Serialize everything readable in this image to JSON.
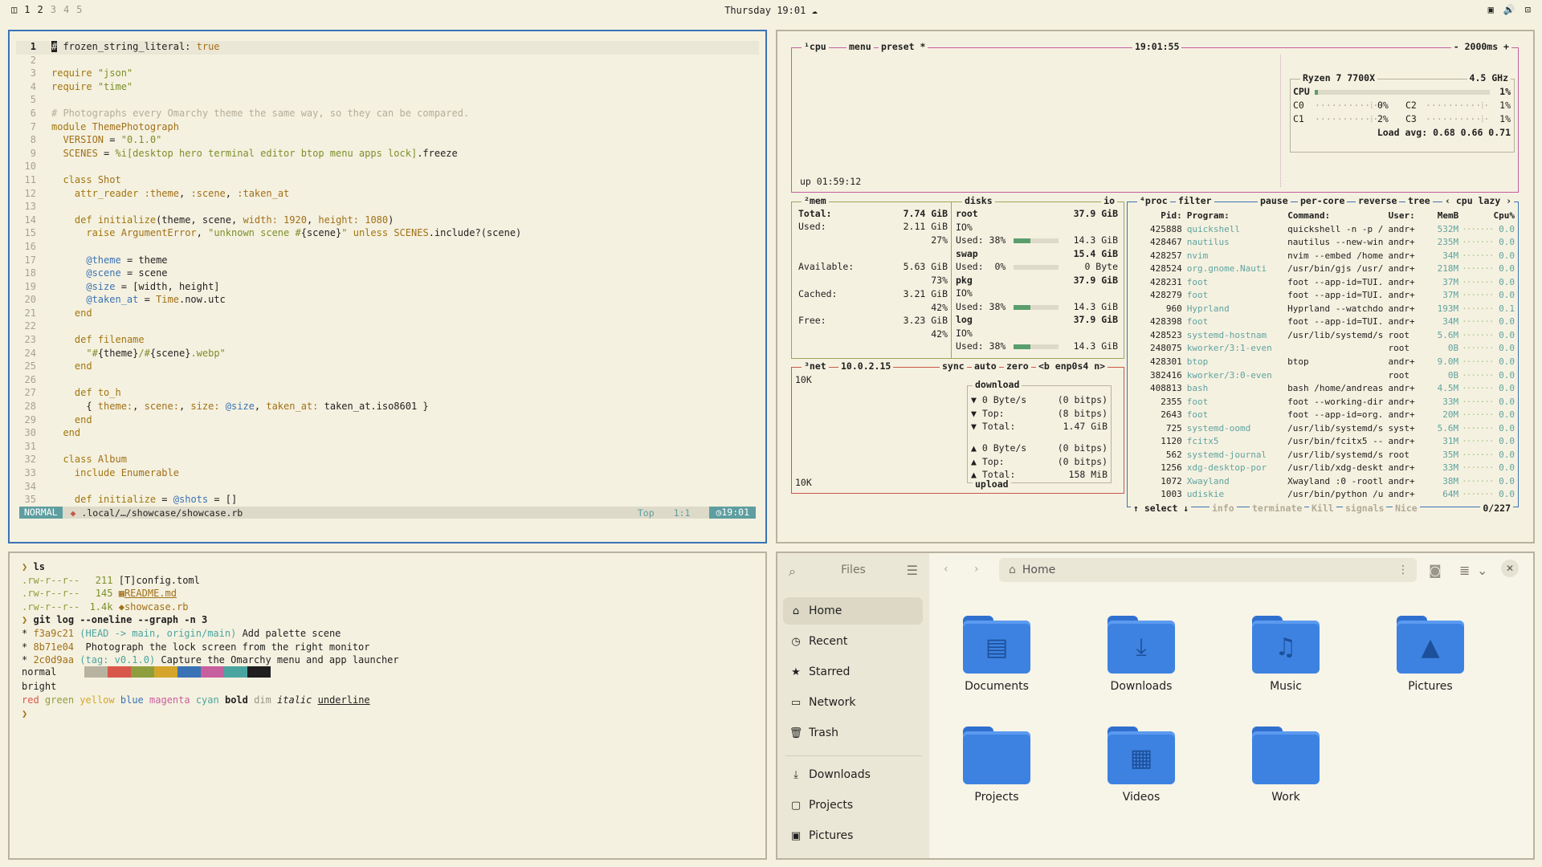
{
  "topbar": {
    "workspaces": [
      "1",
      "2",
      "3",
      "4",
      "5"
    ],
    "clock": "Thursday 19:01"
  },
  "editor": {
    "lines": [
      {
        "n": "1",
        "html": "<span style='background:#1f1f1f;color:#f5f1e0'>#</span> frozen_string_literal: <span class='tru'>true</span>"
      },
      {
        "n": "2",
        "html": ""
      },
      {
        "n": "3",
        "html": "<span class='kw'>require</span> <span class='str'>\"json\"</span>"
      },
      {
        "n": "4",
        "html": "<span class='kw'>require</span> <span class='str'>\"time\"</span>"
      },
      {
        "n": "5",
        "html": ""
      },
      {
        "n": "6",
        "html": "<span class='com'># Photographs every Omarchy theme the same way, so they can be compared.</span>"
      },
      {
        "n": "7",
        "html": "<span class='kw'>module</span> <span class='cls'>ThemePhotograph</span>"
      },
      {
        "n": "8",
        "html": "  <span class='cls'>VERSION</span> = <span class='str'>\"0.1.0\"</span>"
      },
      {
        "n": "9",
        "html": "  <span class='cls'>SCENES</span> = <span class='str'>%i[desktop hero terminal editor btop menu apps lock]</span>.freeze"
      },
      {
        "n": "10",
        "html": ""
      },
      {
        "n": "11",
        "html": "  <span class='kw'>class</span> <span class='cls'>Shot</span>"
      },
      {
        "n": "12",
        "html": "    <span class='kw'>attr_reader</span> <span class='sym'>:theme</span>, <span class='sym'>:scene</span>, <span class='sym'>:taken_at</span>"
      },
      {
        "n": "13",
        "html": ""
      },
      {
        "n": "14",
        "html": "    <span class='kw'>def</span> <span class='kw'>initialize</span>(theme, scene, <span class='sym'>width:</span> <span class='num'>1920</span>, <span class='sym'>height:</span> <span class='num'>1080</span>)"
      },
      {
        "n": "15",
        "html": "      <span class='kw'>raise</span> <span class='cls'>ArgumentError</span>, <span class='str'>\"unknown scene #</span>{scene}<span class='str'>\"</span> <span class='kw'>unless</span> <span class='cls'>SCENES</span>.include?(scene)"
      },
      {
        "n": "16",
        "html": ""
      },
      {
        "n": "17",
        "html": "      <span class='ivar'>@theme</span> = theme"
      },
      {
        "n": "18",
        "html": "      <span class='ivar'>@scene</span> = scene"
      },
      {
        "n": "19",
        "html": "      <span class='ivar'>@size</span> = [width, height]"
      },
      {
        "n": "20",
        "html": "      <span class='ivar'>@taken_at</span> = <span class='cls'>Time</span>.now.utc"
      },
      {
        "n": "21",
        "html": "    <span class='kw'>end</span>"
      },
      {
        "n": "22",
        "html": ""
      },
      {
        "n": "23",
        "html": "    <span class='kw'>def</span> <span class='kw'>filename</span>"
      },
      {
        "n": "24",
        "html": "      <span class='str'>\"#</span>{theme}<span class='str'>/#</span>{scene}<span class='str'>.webp\"</span>"
      },
      {
        "n": "25",
        "html": "    <span class='kw'>end</span>"
      },
      {
        "n": "26",
        "html": ""
      },
      {
        "n": "27",
        "html": "    <span class='kw'>def</span> <span class='kw'>to_h</span>"
      },
      {
        "n": "28",
        "html": "      { <span class='sym'>theme:</span>, <span class='sym'>scene:</span>, <span class='sym'>size:</span> <span class='ivar'>@size</span>, <span class='sym'>taken_at:</span> taken_at.iso8601 }"
      },
      {
        "n": "29",
        "html": "    <span class='kw'>end</span>"
      },
      {
        "n": "30",
        "html": "  <span class='kw'>end</span>"
      },
      {
        "n": "31",
        "html": ""
      },
      {
        "n": "32",
        "html": "  <span class='kw'>class</span> <span class='cls'>Album</span>"
      },
      {
        "n": "33",
        "html": "    <span class='kw'>include</span> <span class='cls'>Enumerable</span>"
      },
      {
        "n": "34",
        "html": ""
      },
      {
        "n": "35",
        "html": "    <span class='kw'>def</span> <span class='kw'>initialize</span> = <span class='ivar'>@shots</span> = []"
      }
    ],
    "status": {
      "mode": "NORMAL",
      "file": ".local/…/showcase/showcase.rb",
      "top": "Top",
      "pos": "1:1",
      "time": "19:01"
    }
  },
  "btop": {
    "cpu": {
      "label": "¹cpu",
      "menu": "menu",
      "preset": "preset *",
      "clock": "19:01:55",
      "interval": "- 2000ms +",
      "model": "Ryzen 7 7700X",
      "freq": "4.5 GHz",
      "uptime": "up 01:59:12",
      "cores": [
        {
          "n": "CPU",
          "v": "1%",
          "f": 0.02
        },
        {
          "n": "C0",
          "v": "0%",
          "f": 0
        },
        {
          "n": "C2",
          "v": "1%",
          "f": 0.01
        },
        {
          "n": "C1",
          "v": "2%",
          "f": 0.02
        },
        {
          "n": "C3",
          "v": "1%",
          "f": 0.01
        }
      ],
      "load": "Load avg: 0.68 0.66 0.71"
    },
    "mem": {
      "label": "²mem",
      "total_l": "Total:",
      "total": "7.74 GiB",
      "used_l": "Used:",
      "used": "2.11 GiB",
      "used_p": "27%",
      "avail_l": "Available:",
      "avail": "5.63 GiB",
      "avail_p": "73%",
      "cached_l": "Cached:",
      "cached": "3.21 GiB",
      "cached_p": "42%",
      "free_l": "Free:",
      "free": "3.23 GiB",
      "free_p": "42%"
    },
    "disks": {
      "label": "disks",
      "io": "io",
      "items": [
        {
          "name": "root",
          "size": "37.9 GiB",
          "io": "IO%",
          "used_l": "Used: 38%",
          "used": "14.3 GiB",
          "f": 0.38
        },
        {
          "name": "swap",
          "size": "15.4 GiB",
          "io": "",
          "used_l": "Used:  0%",
          "used": "0 Byte",
          "f": 0
        },
        {
          "name": "pkg",
          "size": "37.9 GiB",
          "io": "IO%",
          "used_l": "Used: 38%",
          "used": "14.3 GiB",
          "f": 0.38
        },
        {
          "name": "log",
          "size": "37.9 GiB",
          "io": "IO%",
          "used_l": "Used: 38%",
          "used": "14.3 GiB",
          "f": 0.38
        }
      ]
    },
    "net": {
      "label": "³net",
      "ip": "10.0.2.15",
      "sync": "sync",
      "auto": "auto",
      "zero": "zero",
      "iface": "<b enp0s4 n>",
      "scale_top": "10K",
      "scale_bot": "10K",
      "download": "download",
      "upload": "upload",
      "dl": [
        [
          "▼ 0 Byte/s",
          "(0 bitps)"
        ],
        [
          "▼ Top:",
          "(8 bitps)"
        ],
        [
          "▼ Total:",
          "1.47 GiB"
        ]
      ],
      "ul": [
        [
          "▲ 0 Byte/s",
          "(0 bitps)"
        ],
        [
          "▲ Top:",
          "(0 bitps)"
        ],
        [
          "▲ Total:",
          "158 MiB"
        ]
      ]
    },
    "proc": {
      "label": "⁴proc",
      "filter": "filter",
      "pause": "pause",
      "percore": "per-core",
      "reverse": "reverse",
      "tree": "tree",
      "sort": "cpu lazy",
      "head": [
        "Pid:",
        "Program:",
        "Command:",
        "User:",
        "MemB",
        "",
        "Cpu%"
      ],
      "rows": [
        [
          "425888",
          "quickshell",
          "quickshell -n -p /",
          "andr+",
          "532M",
          "0.0"
        ],
        [
          "428467",
          "nautilus",
          "nautilus --new-win",
          "andr+",
          "235M",
          "0.0"
        ],
        [
          "428257",
          "nvim",
          "nvim --embed /home",
          "andr+",
          "34M",
          "0.0"
        ],
        [
          "428524",
          "org.gnome.Nauti",
          "/usr/bin/gjs /usr/",
          "andr+",
          "218M",
          "0.0"
        ],
        [
          "428231",
          "foot",
          "foot --app-id=TUI.",
          "andr+",
          "37M",
          "0.0"
        ],
        [
          "428279",
          "foot",
          "foot --app-id=TUI.",
          "andr+",
          "37M",
          "0.0"
        ],
        [
          "960",
          "Hyprland",
          "Hyprland --watchdo",
          "andr+",
          "193M",
          "0.1"
        ],
        [
          "428398",
          "foot",
          "foot --app-id=TUI.",
          "andr+",
          "34M",
          "0.0"
        ],
        [
          "428523",
          "systemd-hostnam",
          "/usr/lib/systemd/s",
          "root",
          "5.6M",
          "0.0"
        ],
        [
          "248075",
          "kworker/3:1-even",
          "",
          "root",
          "0B",
          "0.0"
        ],
        [
          "428301",
          "btop",
          "btop",
          "andr+",
          "9.0M",
          "0.0"
        ],
        [
          "382416",
          "kworker/3:0-even",
          "",
          "root",
          "0B",
          "0.0"
        ],
        [
          "408813",
          "bash",
          "bash /home/andreas",
          "andr+",
          "4.5M",
          "0.0"
        ],
        [
          "2355",
          "foot",
          "foot --working-dir",
          "andr+",
          "33M",
          "0.0"
        ],
        [
          "2643",
          "foot",
          "foot --app-id=org.",
          "andr+",
          "20M",
          "0.0"
        ],
        [
          "725",
          "systemd-oomd",
          "/usr/lib/systemd/s",
          "syst+",
          "5.6M",
          "0.0"
        ],
        [
          "1120",
          "fcitx5",
          "/usr/bin/fcitx5 --",
          "andr+",
          "31M",
          "0.0"
        ],
        [
          "562",
          "systemd-journal",
          "/usr/lib/systemd/s",
          "root",
          "35M",
          "0.0"
        ],
        [
          "1256",
          "xdg-desktop-por",
          "/usr/lib/xdg-deskt",
          "andr+",
          "33M",
          "0.0"
        ],
        [
          "1072",
          "Xwayland",
          "Xwayland :0 -rootl",
          "andr+",
          "38M",
          "0.0"
        ],
        [
          "1003",
          "udiskie",
          "/usr/bin/python /u",
          "andr+",
          "64M",
          "0.0"
        ]
      ],
      "footer": {
        "select": "↑ select ↓",
        "info": "info",
        "terminate": "terminate",
        "kill": "Kill",
        "signals": "signals",
        "nice": "Nice",
        "count": "0/227"
      }
    }
  },
  "terminal": {
    "prompt": "❯",
    "cmd1": "ls",
    "files": [
      {
        "perm": ".rw-r--r--",
        "size": "211",
        "icon": "[T]",
        "name": "config.toml",
        "col": "#1f1f1f"
      },
      {
        "perm": ".rw-r--r--",
        "size": "145",
        "icon": "▦",
        "name": "README.md",
        "col": "#a07018"
      },
      {
        "perm": ".rw-r--r--",
        "size": "1.4k",
        "icon": "◆",
        "name": "showcase.rb",
        "col": "#a07018"
      }
    ],
    "cmd2": "git log --oneline --graph -n 3",
    "commits": [
      {
        "hash": "f3a9c21",
        "ref": "(HEAD -> main, origin/main)",
        "msg": "Add palette scene"
      },
      {
        "hash": "8b71e04",
        "ref": "",
        "msg": "Photograph the lock screen from the right monitor"
      },
      {
        "hash": "2c0d9aa",
        "ref": "(tag: v0.1.0)",
        "msg": "Capture the Omarchy menu and app launcher"
      }
    ],
    "normal": "normal",
    "bright": "bright",
    "palette": [
      "#b8b2a0",
      "#d9574a",
      "#8e9e3e",
      "#d4a52a",
      "#3a73b5",
      "#c85f9f",
      "#4aa5a0",
      "#1f1f1f"
    ],
    "styles": [
      "red",
      "green",
      "yellow",
      "blue",
      "magenta",
      "cyan",
      "bold",
      "dim",
      "italic",
      "underline"
    ]
  },
  "files": {
    "title": "Files",
    "path": "Home",
    "sidebar": [
      {
        "icon": "⌂",
        "label": "Home"
      },
      {
        "icon": "◷",
        "label": "Recent"
      },
      {
        "icon": "★",
        "label": "Starred"
      },
      {
        "icon": "▭",
        "label": "Network"
      },
      {
        "icon": "🗑",
        "label": "Trash"
      },
      {
        "icon": "⤓",
        "label": "Downloads"
      },
      {
        "icon": "▢",
        "label": "Projects"
      },
      {
        "icon": "▣",
        "label": "Pictures"
      }
    ],
    "folders": [
      {
        "name": "Documents",
        "glyph": "▤"
      },
      {
        "name": "Downloads",
        "glyph": "⤓"
      },
      {
        "name": "Music",
        "glyph": "♫"
      },
      {
        "name": "Pictures",
        "glyph": "▲"
      },
      {
        "name": "Projects",
        "glyph": ""
      },
      {
        "name": "Videos",
        "glyph": "▦"
      },
      {
        "name": "Work",
        "glyph": ""
      }
    ]
  }
}
